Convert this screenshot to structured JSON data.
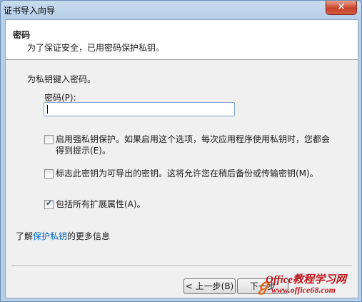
{
  "window": {
    "title": "证书导入向导",
    "close_glyph": "✕"
  },
  "header": {
    "title": "密码",
    "description": "为了保证安全，已用密码保护私钥。"
  },
  "body": {
    "prompt": "为私钥键入密码。",
    "password_label": "密码(P):",
    "password_value": "",
    "options": [
      {
        "label_line1": "启用强私钥保护。如果启用这个选项，每次应用程序使用私钥时，您都会",
        "label_line2": "得到提示(E)。",
        "checked": false
      },
      {
        "label": "标志此密钥为可导出的密钥。这将允许您在稍后备份或传输密钥(M)。",
        "checked": false
      },
      {
        "label": "包括所有扩展属性(A)。",
        "checked": true
      }
    ],
    "info_prefix": "了解",
    "info_link": "保护私钥",
    "info_suffix": "的更多信息"
  },
  "footer": {
    "back_label": "< 上一步(B)",
    "next_label": "下一步"
  },
  "watermark": {
    "brand": "Office教程学习网",
    "url": "www.office68.com"
  },
  "colors": {
    "link": "#0066cc",
    "close_button": "#c9432b",
    "watermark": "#c0171d"
  }
}
